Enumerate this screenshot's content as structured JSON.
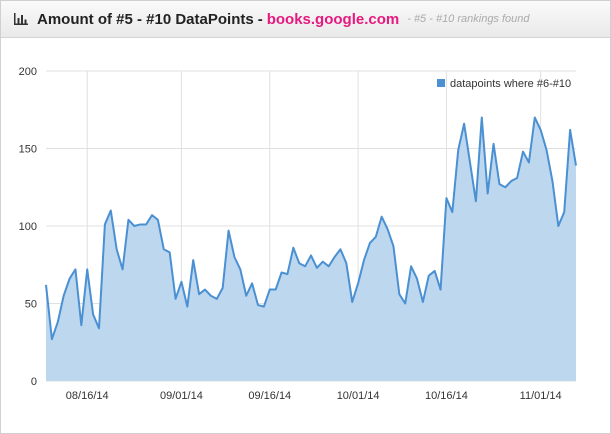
{
  "header": {
    "icon": "bar-chart-icon",
    "title": "Amount of #5 - #10 DataPoints",
    "separator": "-",
    "site": "books.google.com",
    "subtitle": "- #5 - #10 rankings found"
  },
  "colors": {
    "site_accent": "#e6197e",
    "line": "#4a90d2",
    "fill": "#bdd7ef",
    "grid": "#e0e0e0"
  },
  "chart_data": {
    "type": "area",
    "series": [
      {
        "name": "datapoints where #6-#10",
        "values": [
          62,
          27,
          38,
          55,
          66,
          72,
          36,
          72,
          43,
          34,
          101,
          110,
          85,
          72,
          104,
          100,
          101,
          101,
          107,
          104,
          85,
          83,
          53,
          64,
          48,
          78,
          56,
          59,
          55,
          53,
          60,
          97,
          80,
          72,
          55,
          63,
          49,
          48,
          59,
          59,
          70,
          69,
          86,
          76,
          74,
          81,
          73,
          77,
          74,
          80,
          85,
          76,
          51,
          63,
          78,
          89,
          93,
          106,
          98,
          87,
          56,
          50,
          74,
          66,
          51,
          68,
          71,
          59,
          118,
          109,
          149,
          166,
          141,
          116,
          170,
          121,
          153,
          127,
          125,
          129,
          131,
          148,
          141,
          170,
          162,
          149,
          129,
          100,
          109,
          162,
          139
        ]
      }
    ],
    "x_tick_labels": [
      "08/16/14",
      "09/01/14",
      "09/16/14",
      "10/01/14",
      "10/16/14",
      "11/01/14"
    ],
    "x_tick_indices": [
      7,
      23,
      38,
      53,
      68,
      84
    ],
    "y_ticks": [
      0,
      50,
      100,
      150,
      200
    ],
    "ylim": [
      0,
      200
    ],
    "grid": true,
    "legend_position": "top-right"
  }
}
